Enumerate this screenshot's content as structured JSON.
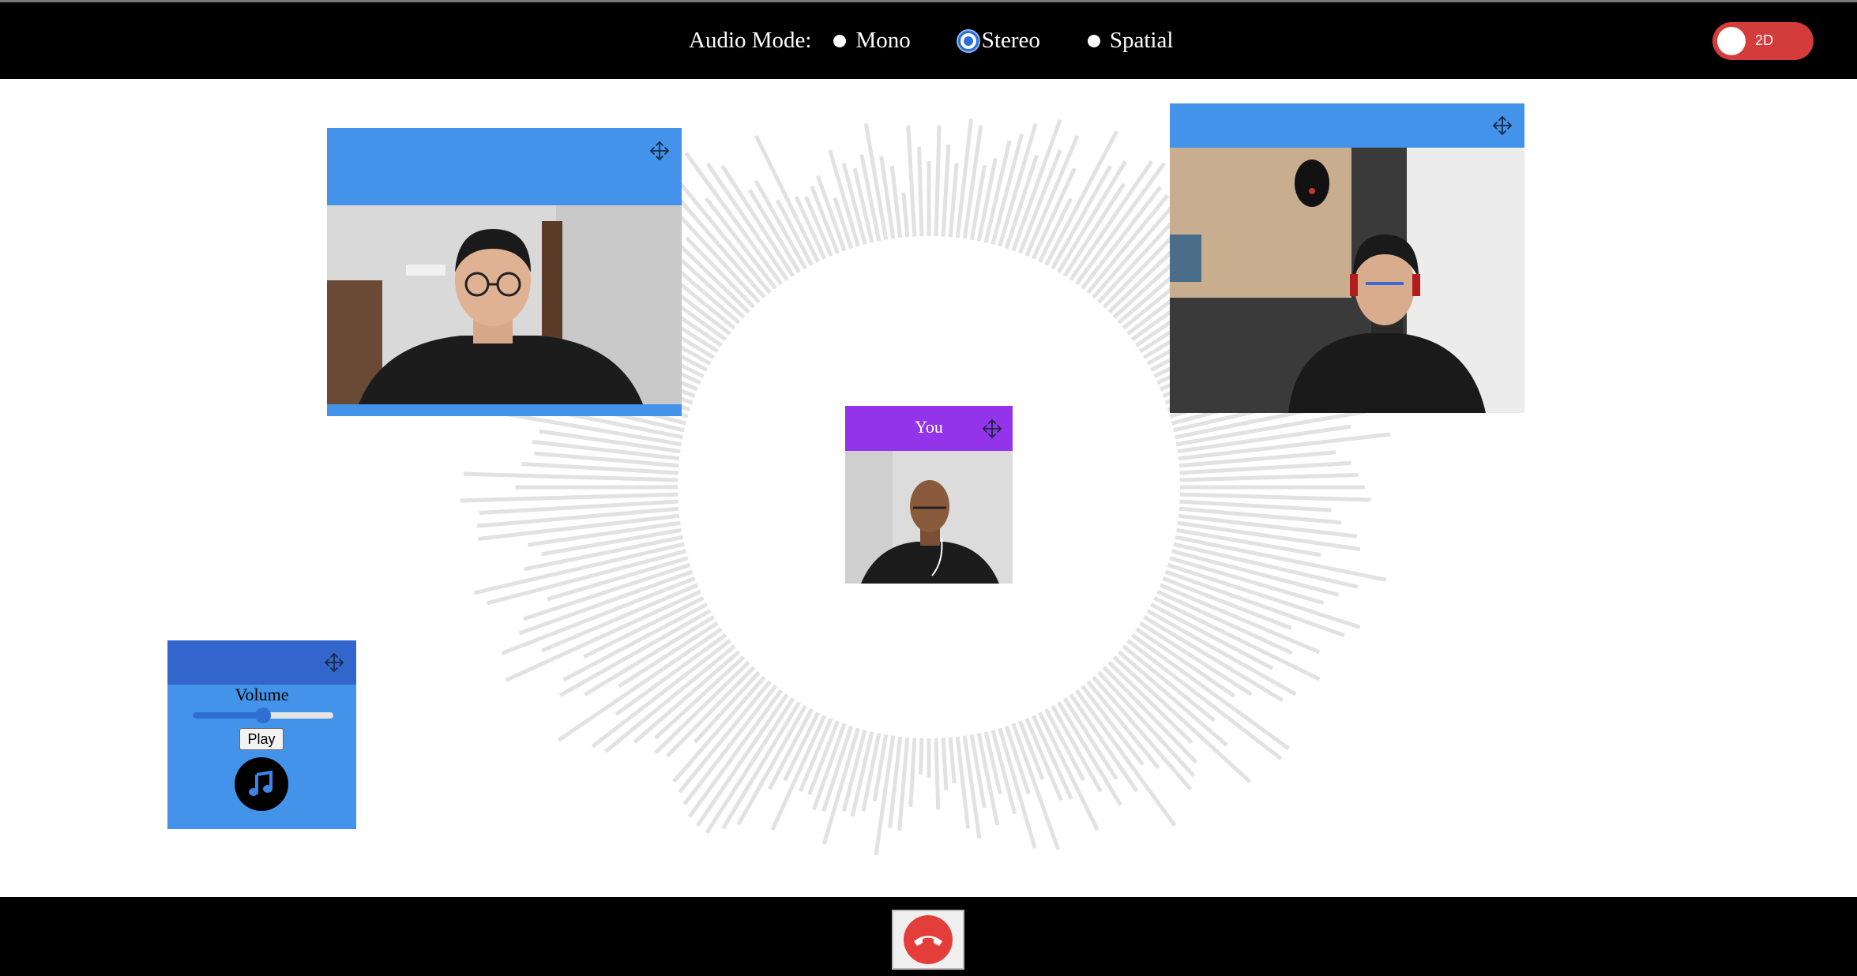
{
  "topbar": {
    "audio_mode_label": "Audio Mode:",
    "options": [
      {
        "label": "Mono",
        "selected": false
      },
      {
        "label": "Stereo",
        "selected": true
      },
      {
        "label": "Spatial",
        "selected": false
      }
    ],
    "view_toggle_label": "2D"
  },
  "tiles": {
    "self_label": "You",
    "participant1_label": "",
    "participant2_label": ""
  },
  "player": {
    "volume_label": "Volume",
    "volume_level": 0.5,
    "play_label": "Play",
    "icon": "music-note-icon"
  },
  "controls": {
    "hangup_icon": "phone-hangup-icon"
  },
  "colors": {
    "tile_blue": "#4393ea",
    "player_header": "#3366cc",
    "self_header": "#9333ea",
    "toggle_red": "#d33c3a",
    "hangup_red": "#e43e3b",
    "visualizer_gray": "#e2e2e2"
  }
}
